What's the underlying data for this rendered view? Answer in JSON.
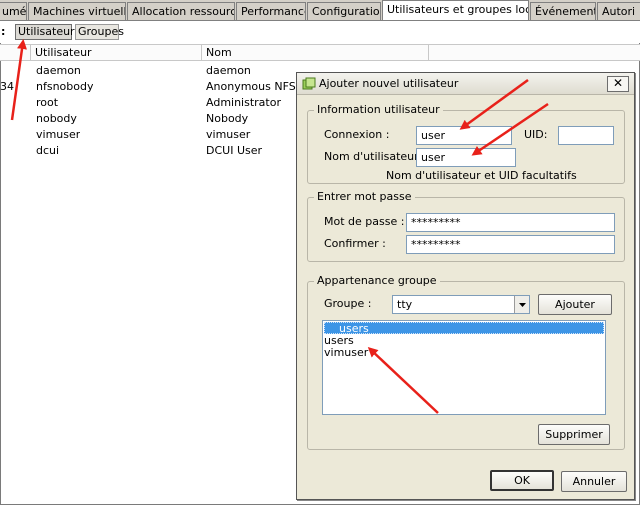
{
  "tabs": [
    {
      "label": "umé",
      "active": false
    },
    {
      "label": "Machines virtuelles",
      "active": false
    },
    {
      "label": "Allocation ressources",
      "active": false
    },
    {
      "label": "Performance",
      "active": false
    },
    {
      "label": "Configuration",
      "active": false
    },
    {
      "label": "Utilisateurs et groupes locaux",
      "active": true
    },
    {
      "label": "Événements",
      "active": false
    },
    {
      "label": "Autori",
      "active": false
    }
  ],
  "subbar": {
    "colon": ":",
    "users_label": "Utilisateurs",
    "groups_label": "Groupes"
  },
  "table": {
    "columns": [
      "Utilisateur",
      "Nom"
    ],
    "rows": [
      {
        "prefix": "",
        "user": "daemon",
        "name": "daemon"
      },
      {
        "prefix": "34",
        "user": "nfsnobody",
        "name": "Anonymous NFS Us"
      },
      {
        "prefix": "",
        "user": "root",
        "name": "Administrator"
      },
      {
        "prefix": "",
        "user": "nobody",
        "name": "Nobody"
      },
      {
        "prefix": "",
        "user": "vimuser",
        "name": "vimuser"
      },
      {
        "prefix": "",
        "user": "dcui",
        "name": "DCUI User"
      }
    ]
  },
  "dialog": {
    "title": "Ajouter nouvel utilisateur",
    "close_glyph": "✕",
    "info_group": {
      "legend": "Information utilisateur",
      "login_label": "Connexion :",
      "login_value": "user",
      "uid_label": "UID:",
      "uid_value": "",
      "username_label": "Nom d'utilisateur :",
      "username_value": "user",
      "hint": "Nom d'utilisateur et UID facultatifs"
    },
    "password_group": {
      "legend": "Entrer mot passe",
      "password_label": "Mot de passe :",
      "password_value": "*********",
      "confirm_label": "Confirmer :",
      "confirm_value": "*********"
    },
    "membership_group": {
      "legend": "Appartenance groupe",
      "group_label": "Groupe :",
      "group_value": "tty",
      "add_label": "Ajouter",
      "items": [
        {
          "label": "users",
          "selected": true
        },
        {
          "label": "users",
          "selected": false
        },
        {
          "label": "vimuser",
          "selected": false
        }
      ],
      "remove_label": "Supprimer"
    },
    "ok_label": "OK",
    "cancel_label": "Annuler"
  },
  "annotation_color": "#e8211a",
  "selection_color": "#3d95e6"
}
